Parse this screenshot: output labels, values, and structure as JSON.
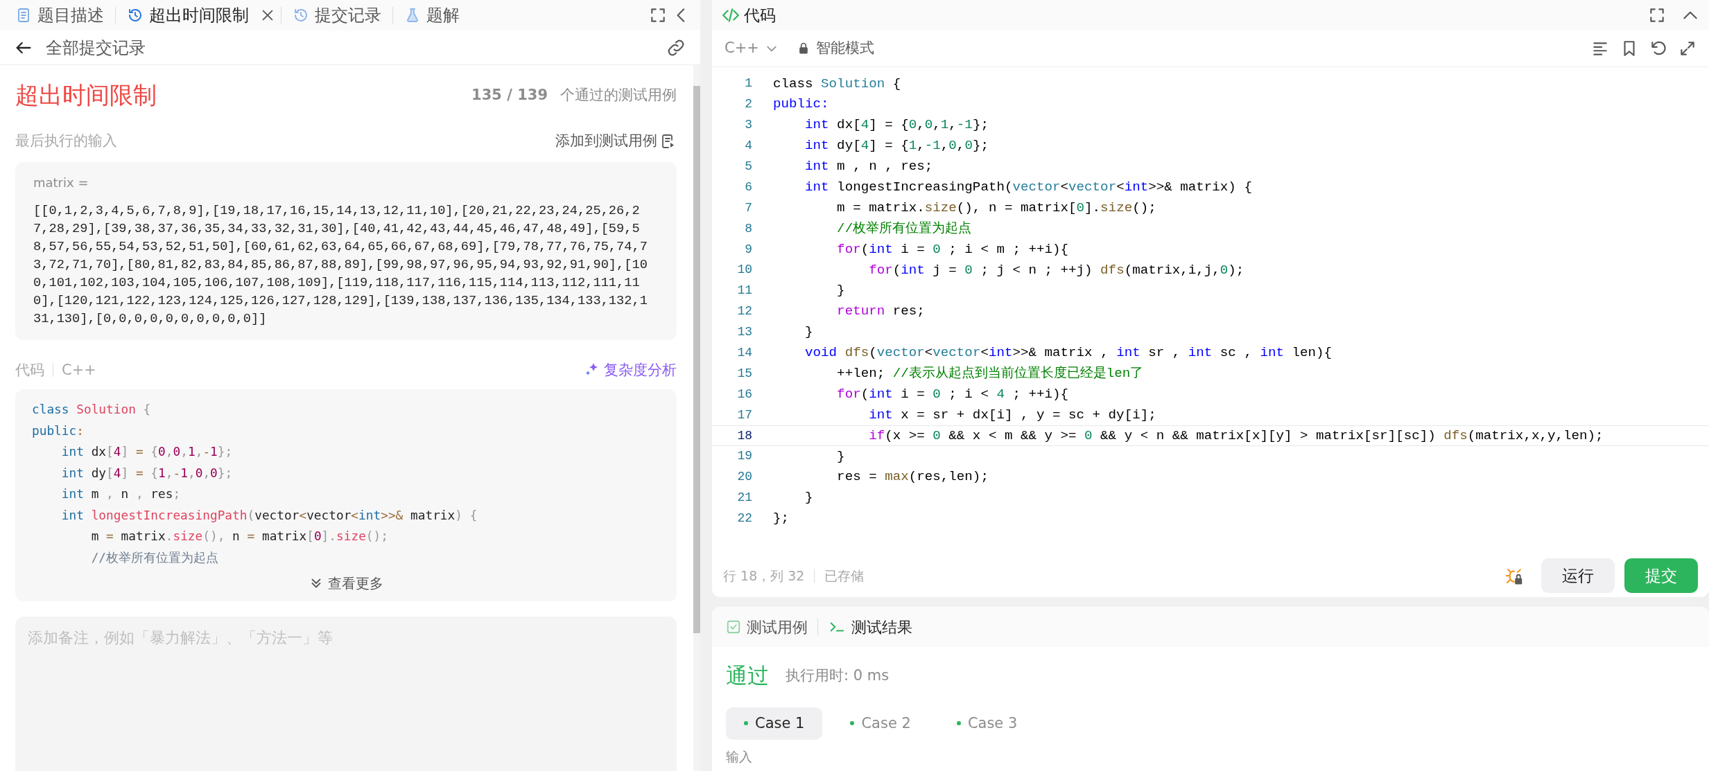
{
  "left_panel": {
    "tabs": [
      {
        "label": "题目描述",
        "selected": false,
        "closable": false
      },
      {
        "label": "超出时间限制",
        "selected": true,
        "closable": true
      },
      {
        "label": "提交记录",
        "selected": false,
        "closable": false
      },
      {
        "label": "题解",
        "selected": false,
        "closable": false
      }
    ],
    "back_link": "全部提交记录",
    "result": {
      "status": "超出时间限制",
      "passed": "135 / 139",
      "passed_label": "个通过的测试用例"
    },
    "last_input": {
      "label": "最后执行的输入",
      "add_button": "添加到测试用例",
      "var_name": "matrix =",
      "value": "[[0,1,2,3,4,5,6,7,8,9],[19,18,17,16,15,14,13,12,11,10],[20,21,22,23,24,25,26,27,28,29],[39,38,37,36,35,34,33,32,31,30],[40,41,42,43,44,45,46,47,48,49],[59,58,57,56,55,54,53,52,51,50],[60,61,62,63,64,65,66,67,68,69],[79,78,77,76,75,74,73,72,71,70],[80,81,82,83,84,85,86,87,88,89],[99,98,97,96,95,94,93,92,91,90],[100,101,102,103,104,105,106,107,108,109],[119,118,117,116,115,114,113,112,111,110],[120,121,122,123,124,125,126,127,128,129],[139,138,137,136,135,134,133,132,131,130],[0,0,0,0,0,0,0,0,0,0]]"
    },
    "code": {
      "label": "代码",
      "language": "C++",
      "analyze_button": "复杂度分析",
      "more_button": "查看更多",
      "lines": [
        [
          {
            "text": "class",
            "kind": "kw"
          },
          {
            "text": " Solution",
            "kind": "title"
          },
          {
            "text": " {",
            "kind": "punct"
          }
        ],
        [
          {
            "text": "public",
            "kind": "kw"
          },
          {
            "text": ":",
            "kind": "op"
          }
        ],
        [
          {
            "text": "    int",
            "kind": "kw"
          },
          {
            "text": " dx",
            "kind": "p"
          },
          {
            "text": "[",
            "kind": "punct"
          },
          {
            "text": "4",
            "kind": "num"
          },
          {
            "text": "]",
            "kind": "punct"
          },
          {
            "text": " =",
            "kind": "op"
          },
          {
            "text": " {",
            "kind": "punct"
          },
          {
            "text": "0",
            "kind": "num"
          },
          {
            "text": ",",
            "kind": "punct"
          },
          {
            "text": "0",
            "kind": "num"
          },
          {
            "text": ",",
            "kind": "punct"
          },
          {
            "text": "1",
            "kind": "num"
          },
          {
            "text": ",",
            "kind": "punct"
          },
          {
            "text": "-",
            "kind": "op"
          },
          {
            "text": "1",
            "kind": "num"
          },
          {
            "text": "};",
            "kind": "punct"
          }
        ],
        [
          {
            "text": "    int",
            "kind": "kw"
          },
          {
            "text": " dy",
            "kind": "p"
          },
          {
            "text": "[",
            "kind": "punct"
          },
          {
            "text": "4",
            "kind": "num"
          },
          {
            "text": "]",
            "kind": "punct"
          },
          {
            "text": " =",
            "kind": "op"
          },
          {
            "text": " {",
            "kind": "punct"
          },
          {
            "text": "1",
            "kind": "num"
          },
          {
            "text": ",",
            "kind": "punct"
          },
          {
            "text": "-",
            "kind": "op"
          },
          {
            "text": "1",
            "kind": "num"
          },
          {
            "text": ",",
            "kind": "punct"
          },
          {
            "text": "0",
            "kind": "num"
          },
          {
            "text": ",",
            "kind": "punct"
          },
          {
            "text": "0",
            "kind": "num"
          },
          {
            "text": "};",
            "kind": "punct"
          }
        ],
        [
          {
            "text": "    int",
            "kind": "kw"
          },
          {
            "text": " m ",
            "kind": "p"
          },
          {
            "text": ",",
            "kind": "punct"
          },
          {
            "text": " n ",
            "kind": "p"
          },
          {
            "text": ",",
            "kind": "punct"
          },
          {
            "text": " res",
            "kind": "p"
          },
          {
            "text": ";",
            "kind": "punct"
          }
        ],
        [
          {
            "text": "    int",
            "kind": "kw"
          },
          {
            "text": " longestIncreasingPath",
            "kind": "title"
          },
          {
            "text": "(",
            "kind": "punct"
          },
          {
            "text": "vector",
            "kind": "p"
          },
          {
            "text": "<",
            "kind": "op"
          },
          {
            "text": "vector",
            "kind": "p"
          },
          {
            "text": "<",
            "kind": "op"
          },
          {
            "text": "int",
            "kind": "kw"
          },
          {
            "text": ">>&",
            "kind": "op"
          },
          {
            "text": " matrix",
            "kind": "p"
          },
          {
            "text": ")",
            "kind": "punct"
          },
          {
            "text": " {",
            "kind": "punct"
          }
        ],
        [
          {
            "text": "        m ",
            "kind": "p"
          },
          {
            "text": "=",
            "kind": "op"
          },
          {
            "text": " matrix",
            "kind": "p"
          },
          {
            "text": ".",
            "kind": "punct"
          },
          {
            "text": "size",
            "kind": "title"
          },
          {
            "text": "(),",
            "kind": "punct"
          },
          {
            "text": " n ",
            "kind": "p"
          },
          {
            "text": "=",
            "kind": "op"
          },
          {
            "text": " matrix",
            "kind": "p"
          },
          {
            "text": "[",
            "kind": "punct"
          },
          {
            "text": "0",
            "kind": "num"
          },
          {
            "text": "].",
            "kind": "punct"
          },
          {
            "text": "size",
            "kind": "title"
          },
          {
            "text": "();",
            "kind": "punct"
          }
        ],
        [
          {
            "text": "        //枚举所有位置为起点",
            "kind": "cm"
          }
        ]
      ]
    },
    "note": {
      "placeholder": "添加备注，例如「暴力解法」、「方法一」等"
    }
  },
  "editor_panel": {
    "title": "代码",
    "language": "C++",
    "mode": "智能模式",
    "lines": [
      {
        "number": "1",
        "selected": false,
        "tokens": [
          {
            "text": "class ",
            "kind": "p"
          },
          {
            "text": "Solution",
            "kind": "type"
          },
          {
            "text": " {",
            "kind": "p"
          }
        ]
      },
      {
        "number": "2",
        "selected": false,
        "tokens": [
          {
            "text": "public:",
            "kind": "kw"
          }
        ]
      },
      {
        "number": "3",
        "selected": false,
        "tokens": [
          {
            "text": "    int",
            "kind": "kw"
          },
          {
            "text": " dx[",
            "kind": "p"
          },
          {
            "text": "4",
            "kind": "num"
          },
          {
            "text": "] = {",
            "kind": "p"
          },
          {
            "text": "0",
            "kind": "num"
          },
          {
            "text": ",",
            "kind": "p"
          },
          {
            "text": "0",
            "kind": "num"
          },
          {
            "text": ",",
            "kind": "p"
          },
          {
            "text": "1",
            "kind": "num"
          },
          {
            "text": ",",
            "kind": "p"
          },
          {
            "text": "-1",
            "kind": "num"
          },
          {
            "text": "};",
            "kind": "p"
          }
        ]
      },
      {
        "number": "4",
        "selected": false,
        "tokens": [
          {
            "text": "    int",
            "kind": "kw"
          },
          {
            "text": " dy[",
            "kind": "p"
          },
          {
            "text": "4",
            "kind": "num"
          },
          {
            "text": "] = {",
            "kind": "p"
          },
          {
            "text": "1",
            "kind": "num"
          },
          {
            "text": ",",
            "kind": "p"
          },
          {
            "text": "-1",
            "kind": "num"
          },
          {
            "text": ",",
            "kind": "p"
          },
          {
            "text": "0",
            "kind": "num"
          },
          {
            "text": ",",
            "kind": "p"
          },
          {
            "text": "0",
            "kind": "num"
          },
          {
            "text": "};",
            "kind": "p"
          }
        ]
      },
      {
        "number": "5",
        "selected": false,
        "tokens": [
          {
            "text": "    int",
            "kind": "kw"
          },
          {
            "text": " m , n , res;",
            "kind": "p"
          }
        ]
      },
      {
        "number": "6",
        "selected": false,
        "tokens": [
          {
            "text": "    int",
            "kind": "kw"
          },
          {
            "text": " longestIncreasingPath(",
            "kind": "p"
          },
          {
            "text": "vector",
            "kind": "type"
          },
          {
            "text": "<",
            "kind": "p"
          },
          {
            "text": "vector",
            "kind": "type"
          },
          {
            "text": "<",
            "kind": "p"
          },
          {
            "text": "int",
            "kind": "kw"
          },
          {
            "text": ">>& matrix) {",
            "kind": "p"
          }
        ]
      },
      {
        "number": "7",
        "selected": false,
        "tokens": [
          {
            "text": "        m = matrix.",
            "kind": "p"
          },
          {
            "text": "size",
            "kind": "fn"
          },
          {
            "text": "(), n = matrix[",
            "kind": "p"
          },
          {
            "text": "0",
            "kind": "num"
          },
          {
            "text": "].",
            "kind": "p"
          },
          {
            "text": "size",
            "kind": "fn"
          },
          {
            "text": "();",
            "kind": "p"
          }
        ]
      },
      {
        "number": "8",
        "selected": false,
        "tokens": [
          {
            "text": "        //枚举所有位置为起点",
            "kind": "cm"
          }
        ]
      },
      {
        "number": "9",
        "selected": false,
        "tokens": [
          {
            "text": "        for",
            "kind": "ctrl"
          },
          {
            "text": "(",
            "kind": "p"
          },
          {
            "text": "int",
            "kind": "kw"
          },
          {
            "text": " i = ",
            "kind": "p"
          },
          {
            "text": "0",
            "kind": "num"
          },
          {
            "text": " ; i < m ; ++i){",
            "kind": "p"
          }
        ]
      },
      {
        "number": "10",
        "selected": false,
        "tokens": [
          {
            "text": "            for",
            "kind": "ctrl"
          },
          {
            "text": "(",
            "kind": "p"
          },
          {
            "text": "int",
            "kind": "kw"
          },
          {
            "text": " j = ",
            "kind": "p"
          },
          {
            "text": "0",
            "kind": "num"
          },
          {
            "text": " ; j < n ; ++j) ",
            "kind": "p"
          },
          {
            "text": "dfs",
            "kind": "fn"
          },
          {
            "text": "(matrix,i,j,",
            "kind": "p"
          },
          {
            "text": "0",
            "kind": "num"
          },
          {
            "text": ");",
            "kind": "p"
          }
        ]
      },
      {
        "number": "11",
        "selected": false,
        "tokens": [
          {
            "text": "        }",
            "kind": "p"
          }
        ]
      },
      {
        "number": "12",
        "selected": false,
        "tokens": [
          {
            "text": "        return",
            "kind": "ctrl"
          },
          {
            "text": " res;",
            "kind": "p"
          }
        ]
      },
      {
        "number": "13",
        "selected": false,
        "tokens": [
          {
            "text": "    }",
            "kind": "p"
          }
        ]
      },
      {
        "number": "14",
        "selected": false,
        "tokens": [
          {
            "text": "    void",
            "kind": "kw"
          },
          {
            "text": " dfs",
            "kind": "fn"
          },
          {
            "text": "(",
            "kind": "p"
          },
          {
            "text": "vector",
            "kind": "type"
          },
          {
            "text": "<",
            "kind": "p"
          },
          {
            "text": "vector",
            "kind": "type"
          },
          {
            "text": "<",
            "kind": "p"
          },
          {
            "text": "int",
            "kind": "kw"
          },
          {
            "text": ">>& matrix , ",
            "kind": "p"
          },
          {
            "text": "int",
            "kind": "kw"
          },
          {
            "text": " sr , ",
            "kind": "p"
          },
          {
            "text": "int",
            "kind": "kw"
          },
          {
            "text": " sc , ",
            "kind": "p"
          },
          {
            "text": "int",
            "kind": "kw"
          },
          {
            "text": " len){",
            "kind": "p"
          }
        ]
      },
      {
        "number": "15",
        "selected": false,
        "tokens": [
          {
            "text": "        ++len; ",
            "kind": "p"
          },
          {
            "text": "//表示从起点到当前位置长度已经是len了",
            "kind": "cm"
          }
        ]
      },
      {
        "number": "16",
        "selected": false,
        "tokens": [
          {
            "text": "        for",
            "kind": "ctrl"
          },
          {
            "text": "(",
            "kind": "p"
          },
          {
            "text": "int",
            "kind": "kw"
          },
          {
            "text": " i = ",
            "kind": "p"
          },
          {
            "text": "0",
            "kind": "num"
          },
          {
            "text": " ; i < ",
            "kind": "p"
          },
          {
            "text": "4",
            "kind": "num"
          },
          {
            "text": " ; ++i){",
            "kind": "p"
          }
        ]
      },
      {
        "number": "17",
        "selected": false,
        "tokens": [
          {
            "text": "            int",
            "kind": "kw"
          },
          {
            "text": " x = sr + dx[i] , y = sc + dy[i];",
            "kind": "p"
          }
        ]
      },
      {
        "number": "18",
        "selected": true,
        "tokens": [
          {
            "text": "            if",
            "kind": "ctrl"
          },
          {
            "text": "(x >= ",
            "kind": "p"
          },
          {
            "text": "0",
            "kind": "num"
          },
          {
            "text": " && x < m && y >= ",
            "kind": "p"
          },
          {
            "text": "0",
            "kind": "num"
          },
          {
            "text": " && y < n && matrix[x][y] > matrix[sr][sc]) ",
            "kind": "p"
          },
          {
            "text": "dfs",
            "kind": "fn"
          },
          {
            "text": "(matrix,x,y,len);",
            "kind": "p"
          }
        ]
      },
      {
        "number": "19",
        "selected": false,
        "tokens": [
          {
            "text": "        }",
            "kind": "p"
          }
        ]
      },
      {
        "number": "20",
        "selected": false,
        "tokens": [
          {
            "text": "        res = ",
            "kind": "p"
          },
          {
            "text": "max",
            "kind": "fn"
          },
          {
            "text": "(res,len);",
            "kind": "p"
          }
        ]
      },
      {
        "number": "21",
        "selected": false,
        "tokens": [
          {
            "text": "    }",
            "kind": "p"
          }
        ]
      },
      {
        "number": "22",
        "selected": false,
        "tokens": [
          {
            "text": "};",
            "kind": "p"
          }
        ]
      }
    ],
    "cursor_position": "行 18，列 32",
    "save_state": "已存储",
    "run_button": "运行",
    "submit_button": "提交"
  },
  "result_panel": {
    "tabs": [
      {
        "label": "测试用例",
        "selected": false
      },
      {
        "label": "测试结果",
        "selected": true
      }
    ],
    "status": "通过",
    "runtime": "执行用时: 0 ms",
    "cases": [
      {
        "label": "Case 1",
        "selected": true
      },
      {
        "label": "Case 2",
        "selected": false
      },
      {
        "label": "Case 3",
        "selected": false
      }
    ],
    "input_label": "输入"
  }
}
